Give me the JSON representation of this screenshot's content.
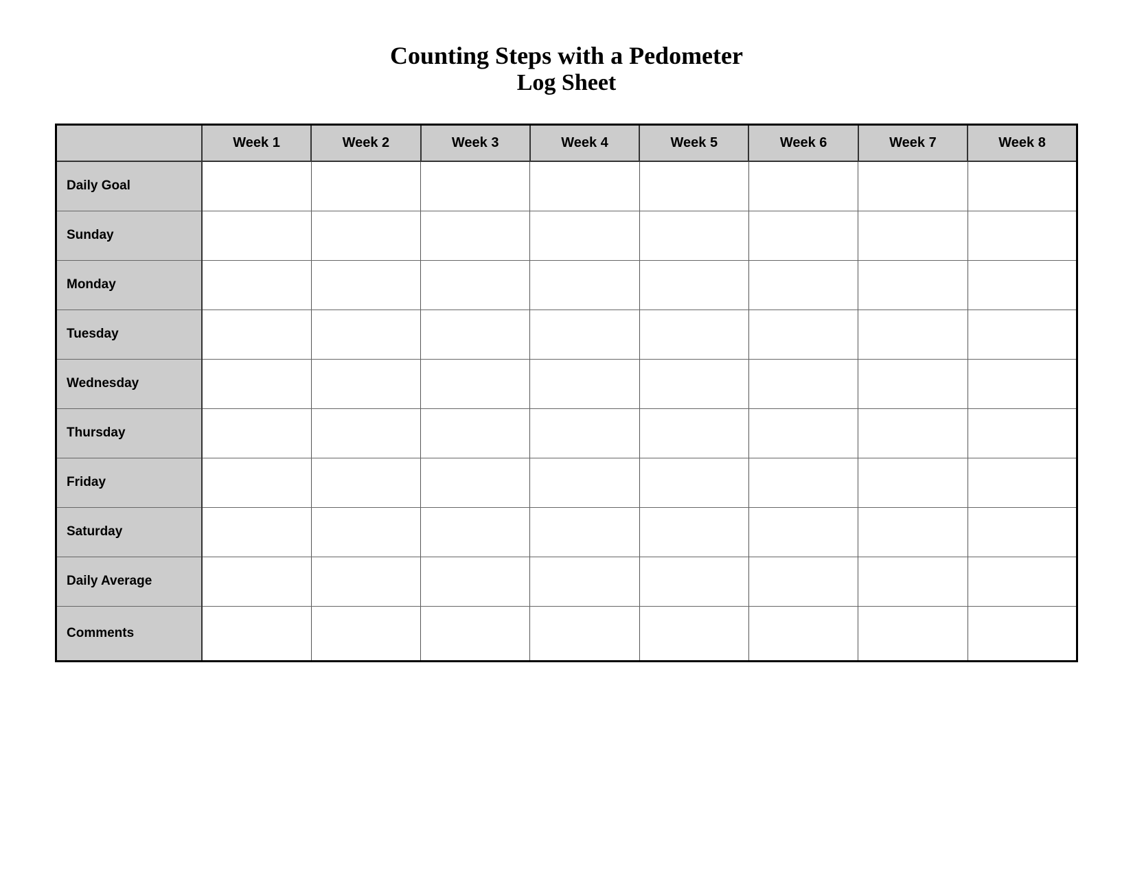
{
  "title": {
    "line1": "Counting Steps with a Pedometer",
    "line2": "Log Sheet"
  },
  "table": {
    "header": {
      "empty": "",
      "columns": [
        "Week 1",
        "Week 2",
        "Week 3",
        "Week 4",
        "Week 5",
        "Week 6",
        "Week 7",
        "Week 8"
      ]
    },
    "rows": [
      {
        "label": "Daily Goal"
      },
      {
        "label": "Sunday"
      },
      {
        "label": "Monday"
      },
      {
        "label": "Tuesday"
      },
      {
        "label": "Wednesday"
      },
      {
        "label": "Thursday"
      },
      {
        "label": "Friday"
      },
      {
        "label": "Saturday"
      },
      {
        "label": "Daily Average"
      },
      {
        "label": "Comments"
      }
    ]
  }
}
